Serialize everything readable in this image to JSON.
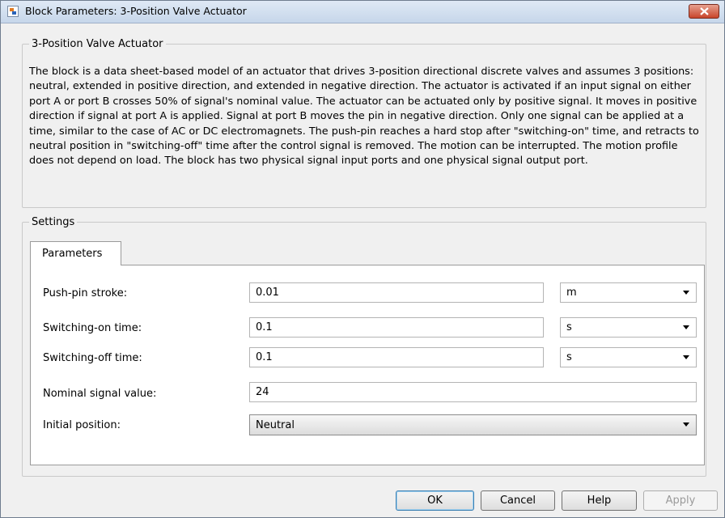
{
  "window": {
    "title": "Block Parameters: 3-Position Valve Actuator"
  },
  "description": {
    "legend": "3-Position Valve Actuator",
    "text": "The block is a data sheet-based model of an actuator that drives 3-position directional discrete valves and assumes 3 positions: neutral, extended in positive direction, and extended in negative direction. The actuator is activated if an input signal on either port A or port B crosses 50% of signal's nominal value. The actuator can be actuated only by positive signal. It moves in positive direction if signal at port A is applied. Signal at port B moves the pin in negative direction. Only one signal can be applied at a time, similar to the case of AC or DC electromagnets. The push-pin reaches a hard stop after \"switching-on\" time, and retracts to neutral position in \"switching-off\" time after the control signal is removed. The motion can be interrupted. The motion profile does not depend on load. The block has two physical signal input ports and one physical signal output port."
  },
  "settings": {
    "legend": "Settings",
    "tab_label": "Parameters",
    "params": {
      "stroke": {
        "label": "Push-pin stroke:",
        "value": "0.01",
        "unit": "m"
      },
      "on_time": {
        "label": "Switching-on time:",
        "value": "0.1",
        "unit": "s"
      },
      "off_time": {
        "label": "Switching-off time:",
        "value": "0.1",
        "unit": "s"
      },
      "nominal": {
        "label": "Nominal signal value:",
        "value": "24"
      },
      "initial": {
        "label": "Initial position:",
        "value": "Neutral"
      }
    }
  },
  "buttons": {
    "ok": "OK",
    "cancel": "Cancel",
    "help": "Help",
    "apply": "Apply"
  }
}
